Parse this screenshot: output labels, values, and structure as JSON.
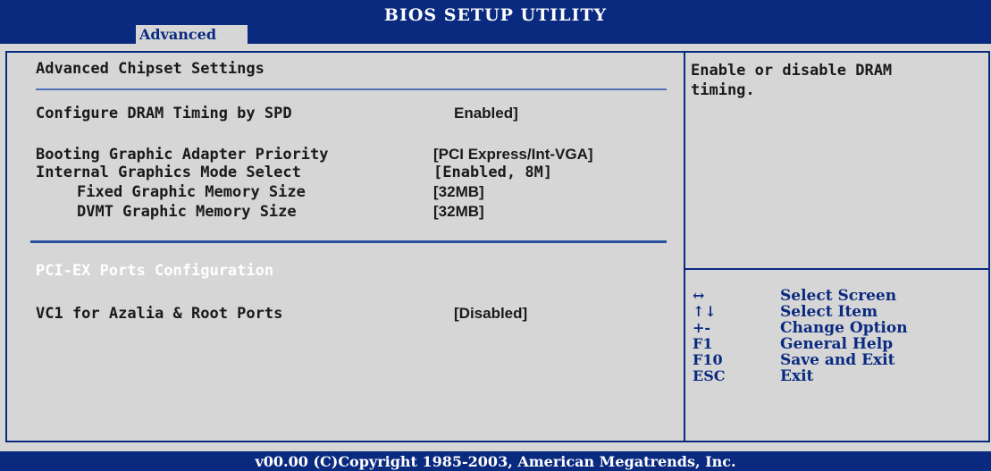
{
  "header": {
    "title": "BIOS SETUP UTILITY",
    "active_tab": "Advanced"
  },
  "main": {
    "section_title": "Advanced Chipset Settings",
    "settings": [
      {
        "label": "Configure DRAM Timing by SPD",
        "value": "Enabled]"
      },
      {
        "label": "Booting Graphic Adapter Priority",
        "value": "[PCI Express/Int-VGA]"
      },
      {
        "label": "Internal Graphics Mode Select",
        "value": "[Enabled, 8M]"
      },
      {
        "label": "Fixed Graphic Memory Size",
        "value": "[32MB]"
      },
      {
        "label": "DVMT Graphic Memory Size",
        "value": "[32MB]"
      }
    ],
    "subsection_title": "PCI-EX Ports Configuration",
    "subsection_settings": [
      {
        "label": "VC1 for Azalia & Root Ports",
        "value": "[Disabled]"
      }
    ]
  },
  "help": {
    "text": "Enable or disable DRAM\ntiming."
  },
  "legend": [
    {
      "key": "↔",
      "desc": "Select Screen"
    },
    {
      "key": "↑↓",
      "desc": "Select Item"
    },
    {
      "key": "+-",
      "desc": "Change Option"
    },
    {
      "key": "F1",
      "desc": "General Help"
    },
    {
      "key": "F10",
      "desc": "Save and Exit"
    },
    {
      "key": "ESC",
      "desc": "Exit"
    }
  ],
  "footer": {
    "text": "v00.00 (C)Copyright 1985-2003, American Megatrends, Inc."
  },
  "colors": {
    "bios_blue": "#0a2a80",
    "background_gray": "#d6d6d6"
  }
}
